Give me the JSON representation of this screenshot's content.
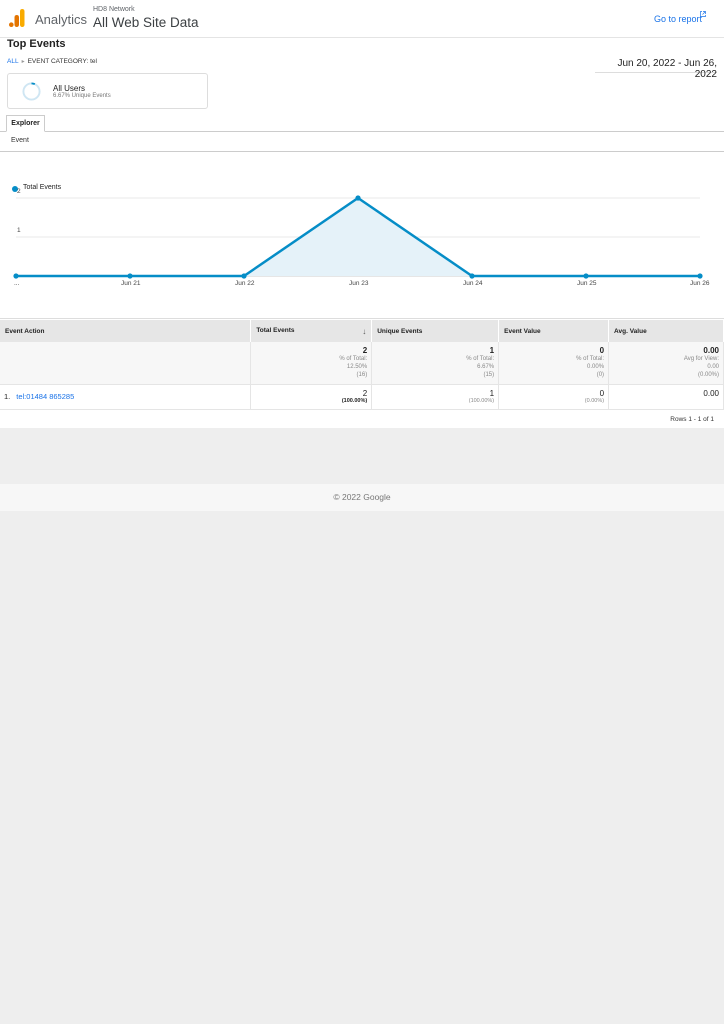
{
  "header": {
    "brand": "Analytics",
    "account": "HD8 Network",
    "property": "All Web Site Data",
    "go_to_report": "Go to report"
  },
  "report": {
    "title": "Top Events",
    "breadcrumb_all": "ALL",
    "breadcrumb_current": "EVENT CATEGORY: tel",
    "date_range": "Jun 20, 2022 - Jun 26, 2022"
  },
  "segment": {
    "name": "All Users",
    "subtitle": "6.67% Unique Events",
    "ring_fraction": 0.0667
  },
  "tabs": {
    "explorer": "Explorer",
    "event": "Event"
  },
  "chart_data": {
    "type": "area",
    "x": [
      "Jun 20",
      "Jun 21",
      "Jun 22",
      "Jun 23",
      "Jun 24",
      "Jun 25",
      "Jun 26"
    ],
    "x_tick_labels": [
      "...",
      "Jun 21",
      "Jun 22",
      "Jun 23",
      "Jun 24",
      "Jun 25",
      "Jun 26"
    ],
    "series": [
      {
        "name": "Total Events",
        "values": [
          0,
          0,
          0,
          2,
          0,
          0,
          0
        ]
      }
    ],
    "ylim": [
      0,
      2
    ],
    "y_ticks": [
      "1",
      "2"
    ],
    "grid": true,
    "legend": "top-left",
    "color": "#058dc7"
  },
  "table": {
    "headers": {
      "event_action": "Event Action",
      "total_events": "Total Events",
      "unique_events": "Unique Events",
      "event_value": "Event Value",
      "avg_value": "Avg. Value"
    },
    "summary": {
      "total_events": {
        "value": "2",
        "line1": "% of Total:",
        "line2": "12.50%",
        "line3": "(16)"
      },
      "unique_events": {
        "value": "1",
        "line1": "% of Total:",
        "line2": "6.67%",
        "line3": "(15)"
      },
      "event_value": {
        "value": "0",
        "line1": "% of Total:",
        "line2": "0.00%",
        "line3": "(0)"
      },
      "avg_value": {
        "value": "0.00",
        "line1": "Avg for View:",
        "line2": "0.00",
        "line3": "(0.00%)"
      }
    },
    "rows": [
      {
        "index": "1.",
        "event_action": "tel:01484 865285",
        "total_events": "2",
        "total_events_pct": "(100.00%)",
        "unique_events": "1",
        "unique_events_pct": "(100.00%)",
        "event_value": "0",
        "event_value_pct": "(0.00%)",
        "avg_value": "0.00"
      }
    ],
    "rows_info": "Rows 1 - 1 of 1"
  },
  "footer": {
    "copyright": "© 2022 Google"
  }
}
